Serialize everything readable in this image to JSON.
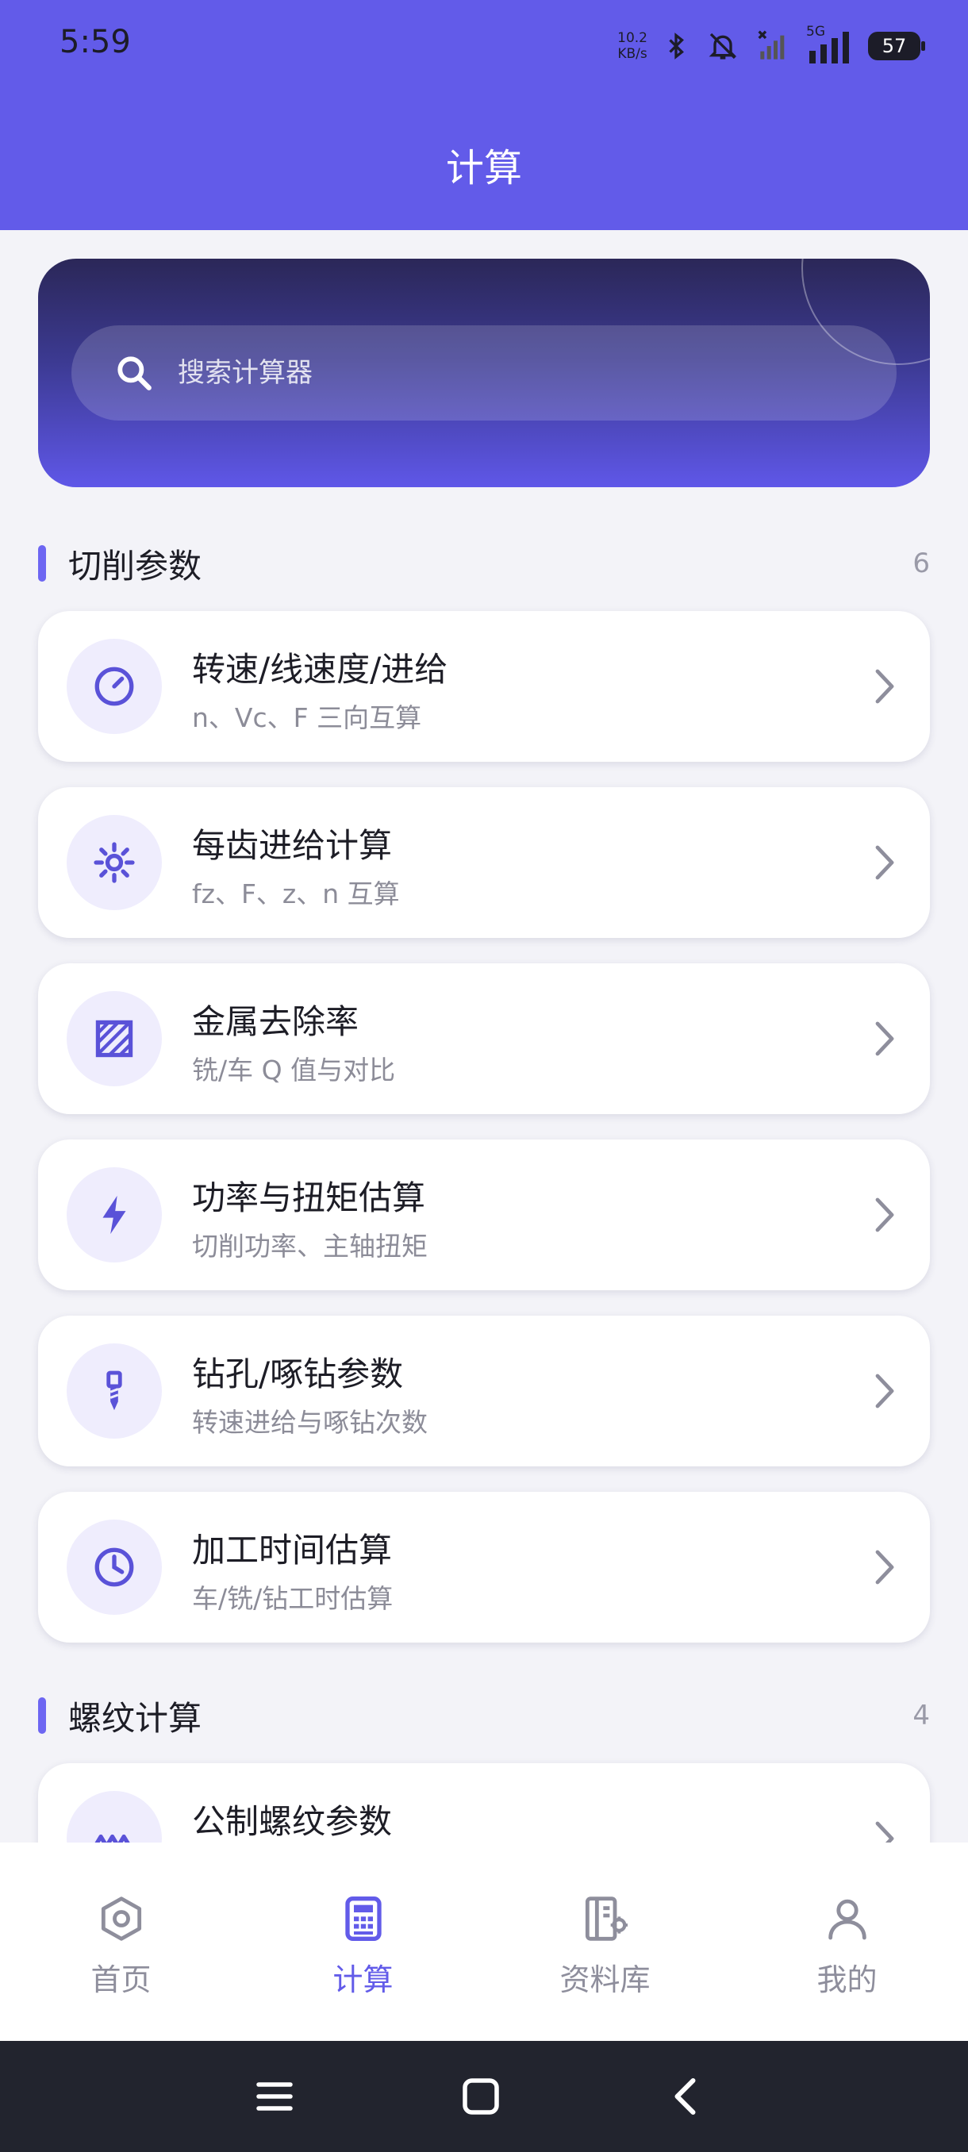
{
  "status": {
    "time": "5:59",
    "net_speed_value": "10.2",
    "net_speed_unit": "KB/s",
    "network": "5G",
    "battery": "57"
  },
  "header": {
    "title": "计算"
  },
  "search": {
    "placeholder": "搜索计算器"
  },
  "sections": [
    {
      "title": "切削参数",
      "count": "6",
      "items": [
        {
          "title": "转速/线速度/进给",
          "subtitle": "n、Vc、F 三向互算",
          "icon": "gauge-icon"
        },
        {
          "title": "每齿进给计算",
          "subtitle": "fz、F、z、n 互算",
          "icon": "sun-gear-icon"
        },
        {
          "title": "金属去除率",
          "subtitle": "铣/车 Q 值与对比",
          "icon": "hatched-square-icon"
        },
        {
          "title": "功率与扭矩估算",
          "subtitle": "切削功率、主轴扭矩",
          "icon": "lightning-icon"
        },
        {
          "title": "钻孔/啄钻参数",
          "subtitle": "转速进给与啄钻次数",
          "icon": "drill-icon"
        },
        {
          "title": "加工时间估算",
          "subtitle": "车/铣/钻工时估算",
          "icon": "clock-icon"
        }
      ]
    },
    {
      "title": "螺纹计算",
      "count": "4",
      "items": [
        {
          "title": "公制螺纹参数",
          "subtitle": "",
          "icon": "thread-icon"
        }
      ]
    }
  ],
  "bottom_nav": [
    {
      "label": "首页",
      "icon": "hexagon-home-icon",
      "active": false
    },
    {
      "label": "计算",
      "icon": "calculator-icon",
      "active": true
    },
    {
      "label": "资料库",
      "icon": "library-icon",
      "active": false
    },
    {
      "label": "我的",
      "icon": "person-icon",
      "active": false
    }
  ],
  "colors": {
    "primary": "#625be9",
    "background": "#f3f3f8",
    "card": "#ffffff",
    "icon_bg": "#efedfd"
  }
}
